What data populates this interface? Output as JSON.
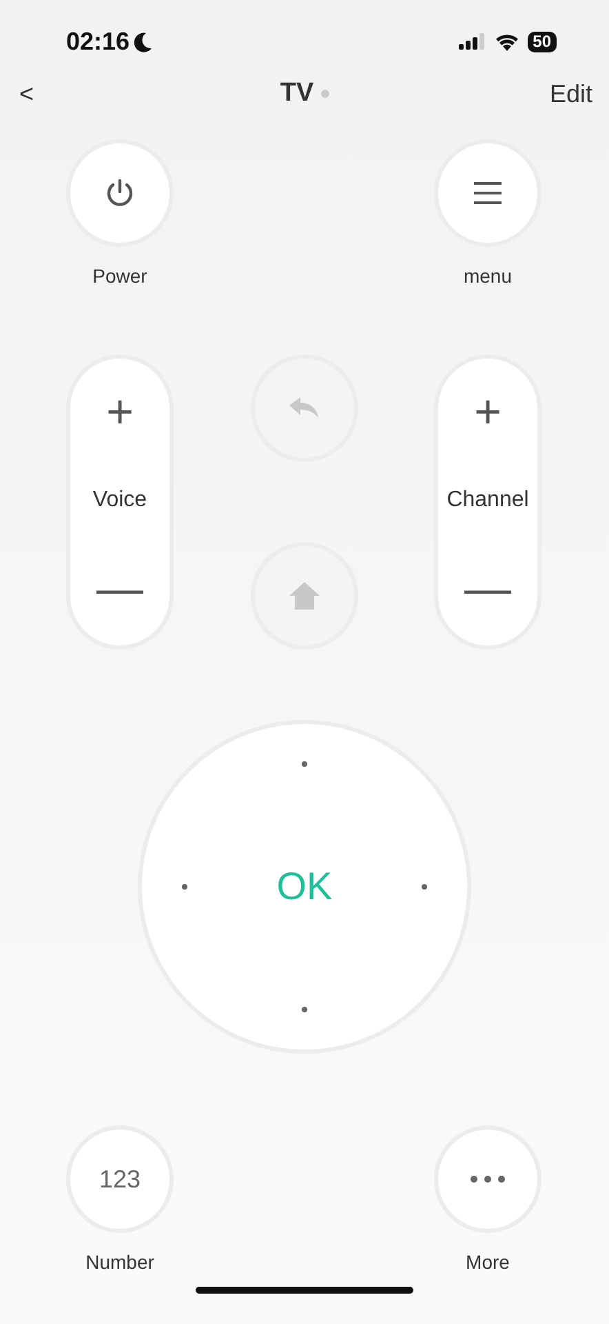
{
  "status_bar": {
    "time": "02:16",
    "battery": "50"
  },
  "nav": {
    "back": "<",
    "title": "TV",
    "edit": "Edit"
  },
  "top_buttons": [
    {
      "kind": "power",
      "label": "Power"
    },
    {
      "kind": "menu",
      "label": "menu"
    }
  ],
  "rockers": [
    {
      "label": "Voice",
      "plus": "+",
      "minus": "—"
    },
    {
      "label": "Channel",
      "plus": "+",
      "minus": "—"
    }
  ],
  "center_buttons": [
    {
      "kind": "back"
    },
    {
      "kind": "home"
    }
  ],
  "dpad": {
    "ok": "OK"
  },
  "bottom_buttons": [
    {
      "kind": "number",
      "text": "123",
      "label": "Number"
    },
    {
      "kind": "more",
      "label": "More"
    }
  ]
}
